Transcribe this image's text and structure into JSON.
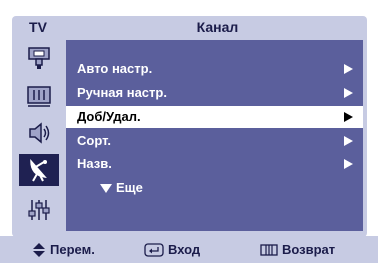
{
  "header": {
    "source_label": "TV",
    "title": "Канал"
  },
  "sidebar": {
    "icons": [
      {
        "name": "input-icon"
      },
      {
        "name": "picture-icon"
      },
      {
        "name": "sound-icon"
      },
      {
        "name": "channel-antenna-icon",
        "active": true
      },
      {
        "name": "setup-sliders-icon"
      }
    ]
  },
  "menu": {
    "items": [
      {
        "label": "Авто настр."
      },
      {
        "label": "Ручная настр."
      },
      {
        "label": "Доб/Удал.",
        "selected": true
      },
      {
        "label": "Сорт."
      },
      {
        "label": "Назв."
      }
    ],
    "more_label": "Еще"
  },
  "footer": {
    "move_label": "Перем.",
    "enter_label": "Вход",
    "return_label": "Возврат"
  },
  "colors": {
    "frame": "#c7cbe3",
    "panel": "#5b5f9c",
    "active_icon_bg": "#1f2152",
    "text_dark": "#1b1c4a",
    "selection": "#ffffff"
  }
}
